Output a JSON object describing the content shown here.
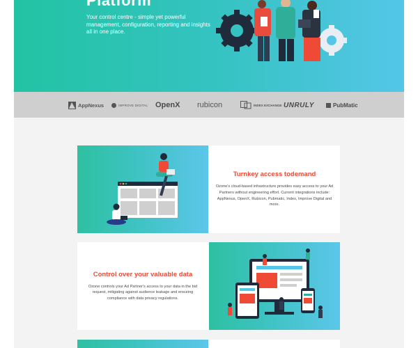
{
  "hero": {
    "title": "Platform",
    "subtitle": "Your control centre - simple yet powerful management, configuration, reporting and insights all in one place."
  },
  "partners": {
    "appnexus": "AppNexus",
    "improve_digital": "IMPROVE DIGITAL",
    "openx": "OpenX",
    "rubicon": "rubicon",
    "index_exchange": "INDEX EXCHANGE",
    "unruly": "UNRULY",
    "pubmatic": "PubMatic"
  },
  "features": [
    {
      "heading": "Turnkey access todemand",
      "body": "Ozone's cloud-based infrastructure provides easy access to your Ad Partners without engineering effort. Current integrations include: AppNexus, OpenX, Rubicon, Pubmatic, Index, Improve Digital and more."
    },
    {
      "heading": "Control over your valuable data",
      "body": "Ozone controls your Ad Partner's access to your data in the bid request, mitigating against audience leakage and ensuring compliance with data privacy regulations."
    }
  ],
  "colors": {
    "accent": "#ef4a35",
    "hero_start": "#22c3a3",
    "hero_end": "#54c6e8",
    "partner_strip": "#cfcfcf"
  }
}
